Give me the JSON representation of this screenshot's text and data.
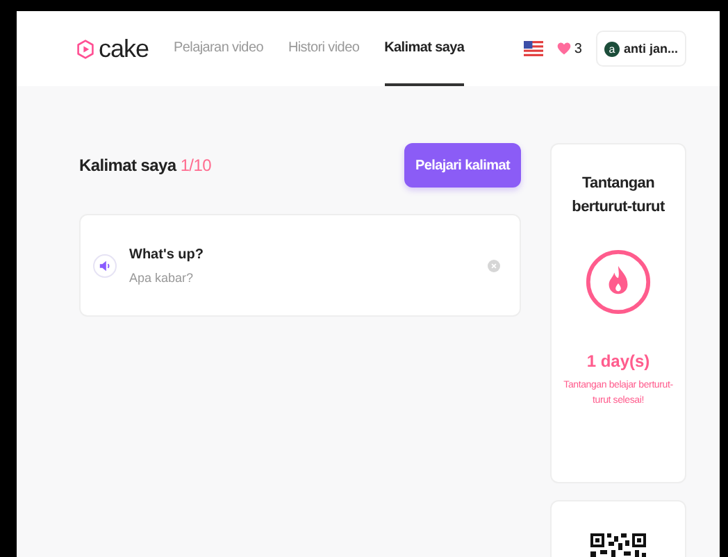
{
  "header": {
    "logo": "cake",
    "nav": [
      {
        "label": "Pelajaran video",
        "selected": false
      },
      {
        "label": "Histori video",
        "selected": false
      },
      {
        "label": "Kalimat saya",
        "selected": true
      }
    ],
    "hearts": "3",
    "profile": {
      "initial": "a",
      "name": "anti jan..."
    }
  },
  "sentences": {
    "title": "Kalimat saya",
    "count": "1/10",
    "button": "Pelajari kalimat",
    "items": [
      {
        "text": "What's up?",
        "translation": "Apa kabar?"
      }
    ]
  },
  "streak": {
    "title": "Tantangan berturut-turut",
    "days": "1 day(s)",
    "message": "Tantangan belajar berturut-turut selesai!"
  }
}
